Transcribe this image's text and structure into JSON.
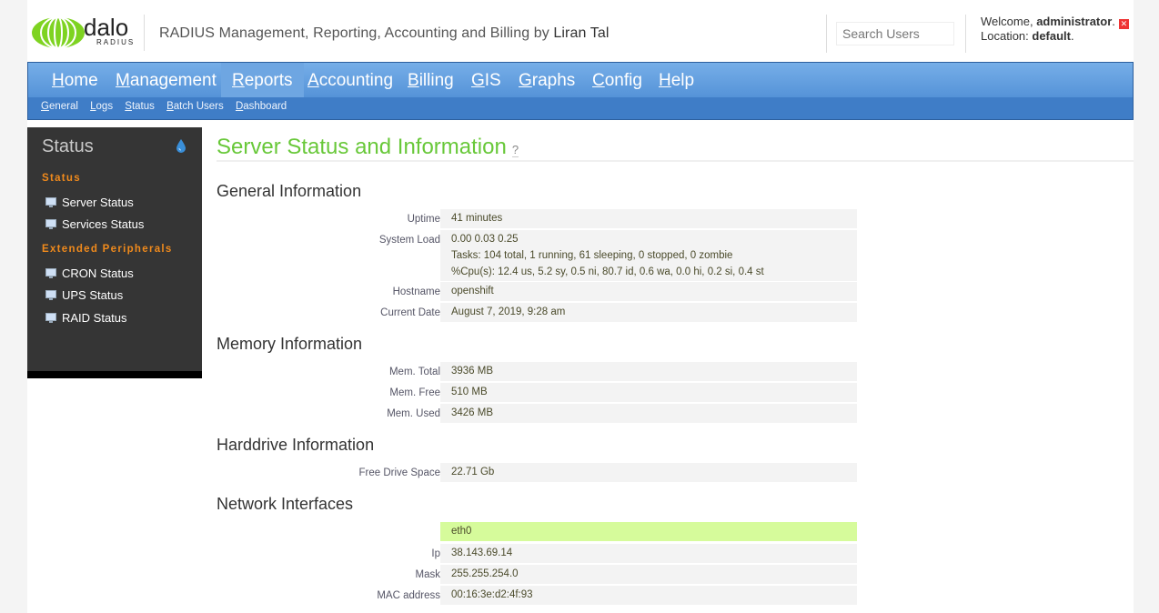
{
  "header": {
    "logo_text_top": "dalo",
    "logo_text_bottom": "RADIUS",
    "tagline": "RADIUS Management, Reporting, Accounting and Billing by",
    "tagline_author": "Liran Tal",
    "search_placeholder": "Search Users",
    "welcome_label": "Welcome,",
    "welcome_user": "administrator",
    "location_label": "Location:",
    "location_value": "default"
  },
  "nav": {
    "items": [
      {
        "u": "H",
        "rest": "ome"
      },
      {
        "u": "M",
        "rest": "anagement"
      },
      {
        "u": "R",
        "rest": "eports"
      },
      {
        "u": "A",
        "rest": "ccounting"
      },
      {
        "u": "B",
        "rest": "illing"
      },
      {
        "u": "G",
        "rest": "IS"
      },
      {
        "u": "G",
        "rest": "raphs"
      },
      {
        "u": "C",
        "rest": "onfig"
      },
      {
        "u": "H",
        "rest": "elp"
      }
    ],
    "sub": [
      {
        "u": "G",
        "rest": "eneral"
      },
      {
        "u": "L",
        "rest": "ogs"
      },
      {
        "u": "S",
        "rest": "tatus"
      },
      {
        "u": "B",
        "rest": "atch Users"
      },
      {
        "u": "D",
        "rest": "ashboard"
      }
    ]
  },
  "sidebar": {
    "title": "Status",
    "group1": "Status",
    "group1_items": [
      "Server Status",
      "Services Status"
    ],
    "group2": "Extended Peripherals",
    "group2_items": [
      "CRON Status",
      "UPS Status",
      "RAID Status"
    ]
  },
  "main": {
    "title": "Server Status and Information",
    "general": {
      "heading": "General Information",
      "uptime_label": "Uptime",
      "uptime": "41 minutes",
      "load_label": "System Load",
      "load_1": "0.00 0.03 0.25",
      "load_2": "Tasks: 104 total, 1 running, 61 sleeping, 0 stopped, 0 zombie",
      "load_3": "%Cpu(s): 12.4 us, 5.2 sy, 0.5 ni, 80.7 id, 0.6 wa, 0.0 hi, 0.2 si, 0.4 st",
      "hostname_label": "Hostname",
      "hostname": "openshift",
      "date_label": "Current Date",
      "date": "August 7, 2019, 9:28 am"
    },
    "memory": {
      "heading": "Memory Information",
      "total_label": "Mem. Total",
      "total": "3936 MB",
      "free_label": "Mem. Free",
      "free": "510 MB",
      "used_label": "Mem. Used",
      "used": "3426 MB"
    },
    "disk": {
      "heading": "Harddrive Information",
      "free_label": "Free Drive Space",
      "free": "22.71 Gb"
    },
    "network": {
      "heading": "Network Interfaces",
      "iface": "eth0",
      "ip_label": "Ip",
      "ip": "38.143.69.14",
      "mask_label": "Mask",
      "mask": "255.255.254.0",
      "mac_label": "MAC address",
      "mac": "00:16:3e:d2:4f:93"
    }
  }
}
